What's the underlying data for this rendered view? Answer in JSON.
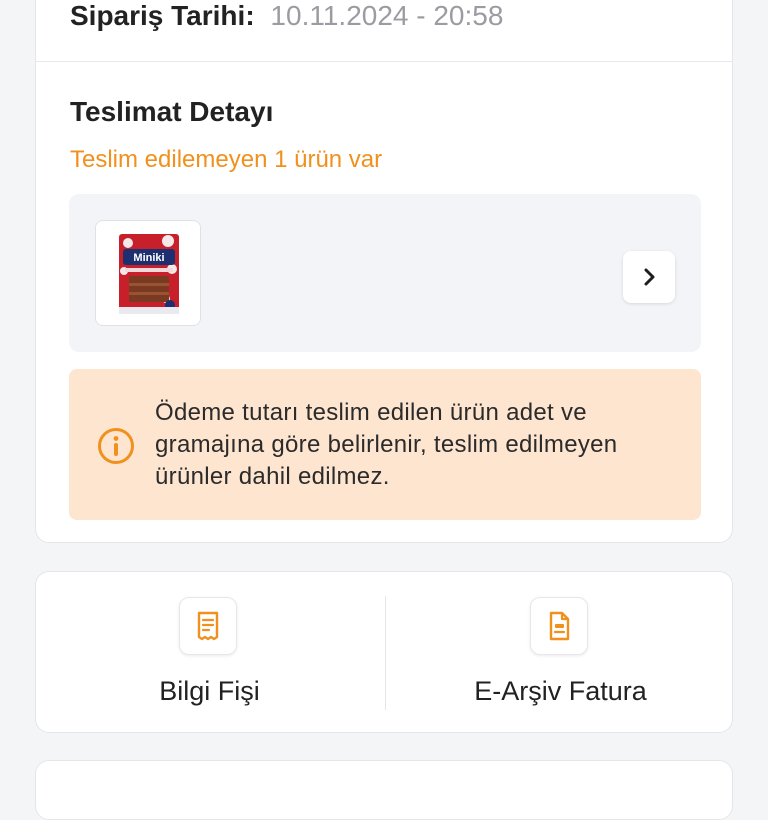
{
  "order": {
    "date_label": "Sipariş Tarihi:",
    "date_value": "10.11.2024 - 20:58"
  },
  "delivery": {
    "title": "Teslimat Detayı",
    "undelivered_note": "Teslim edilemeyen 1 ürün var",
    "product": {
      "brand_text": "Miniki"
    },
    "info_message": "Ödeme tutarı teslim edilen ürün adet ve gramajına göre belirlenir, teslim edilmeyen ürünler dahil edilmez."
  },
  "documents": {
    "items": [
      {
        "label": "Bilgi Fişi",
        "icon": "receipt-icon"
      },
      {
        "label": "E-Arşiv Fatura",
        "icon": "invoice-document-icon"
      }
    ]
  },
  "colors": {
    "accent_orange": "#f0911d",
    "info_background": "#fde5d0",
    "panel_background": "#f2f4f8",
    "muted_text": "#9a9ca1"
  }
}
